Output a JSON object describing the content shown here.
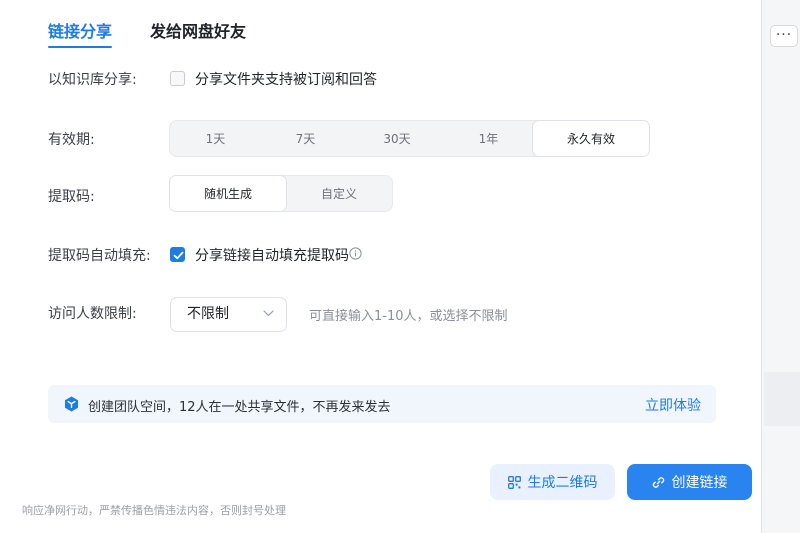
{
  "tabs": [
    {
      "label": "链接分享",
      "active": true
    },
    {
      "label": "发给网盘好友",
      "active": false
    }
  ],
  "kb_share": {
    "label": "以知识库分享:",
    "option": "分享文件夹支持被订阅和回答",
    "checked": false
  },
  "validity": {
    "label": "有效期:",
    "options": [
      "1天",
      "7天",
      "30天",
      "1年",
      "永久有效"
    ],
    "selected": "永久有效"
  },
  "code": {
    "label": "提取码:",
    "options": [
      "随机生成",
      "自定义"
    ],
    "selected": "随机生成"
  },
  "autofill": {
    "label": "提取码自动填充:",
    "option": "分享链接自动填充提取码",
    "checked": true
  },
  "visitors": {
    "label": "访问人数限制:",
    "value": "不限制",
    "hint": "可直接输入1-10人，或选择不限制"
  },
  "banner": {
    "text": "创建团队空间，12人在一处共享文件，不再发来发去",
    "link": "立即体验"
  },
  "buttons": {
    "qr": "生成二维码",
    "create": "创建链接"
  },
  "footer_note": "响应净网行动，严禁传播色情违法内容，否则封号处理",
  "background": {
    "more_label": "···"
  },
  "colors": {
    "accent": "#1f7ce0",
    "primary_button": "#2a84ef"
  }
}
